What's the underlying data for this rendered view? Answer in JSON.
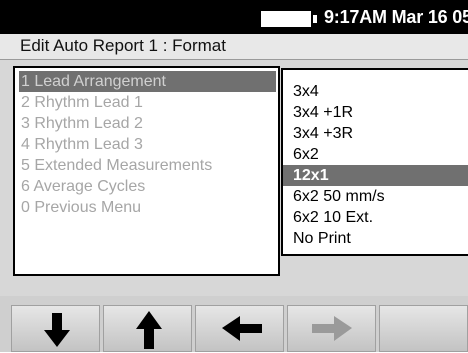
{
  "status": {
    "time": "9:17AM Mar 16 05"
  },
  "icons": {
    "battery": "battery-icon"
  },
  "title": "Edit Auto Report 1 : Format",
  "menu": {
    "items": [
      {
        "label": "1 Lead Arrangement",
        "selected": true
      },
      {
        "label": "2 Rhythm Lead 1",
        "selected": false
      },
      {
        "label": "3 Rhythm Lead 2",
        "selected": false
      },
      {
        "label": "4 Rhythm Lead 3",
        "selected": false
      },
      {
        "label": "5 Extended Measurements",
        "selected": false
      },
      {
        "label": "6 Average Cycles",
        "selected": false
      },
      {
        "label": "0 Previous Menu",
        "selected": false
      }
    ]
  },
  "options": {
    "items": [
      {
        "label": "3x4",
        "selected": false
      },
      {
        "label": "3x4 +1R",
        "selected": false
      },
      {
        "label": "3x4 +3R",
        "selected": false
      },
      {
        "label": "6x2",
        "selected": false
      },
      {
        "label": "12x1",
        "selected": true
      },
      {
        "label": "6x2 50 mm/s",
        "selected": false
      },
      {
        "label": "6x2 10 Ext.",
        "selected": false
      },
      {
        "label": "No Print",
        "selected": false
      }
    ]
  },
  "softkeys": [
    {
      "icon": "arrow-down-icon",
      "enabled": true
    },
    {
      "icon": "arrow-up-icon",
      "enabled": true
    },
    {
      "icon": "arrow-left-icon",
      "enabled": true
    },
    {
      "icon": "arrow-right-icon",
      "enabled": false
    },
    {
      "icon": "",
      "enabled": false
    }
  ],
  "colors": {
    "highlight": "#707070",
    "disabled_text": "#a6a6a6",
    "disabled_arrow": "#9a9a9a"
  }
}
